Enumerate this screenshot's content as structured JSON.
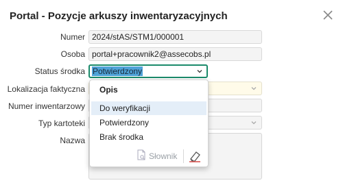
{
  "dialog": {
    "title": "Portal - Pozycje arkuszy inwentaryzacyjnych"
  },
  "fields": {
    "numer": {
      "label": "Numer",
      "value": "2024/stAS/STM1/000001"
    },
    "osoba": {
      "label": "Osoba",
      "value": "portal+pracownik2@assecobs.pl"
    },
    "status": {
      "label": "Status środka",
      "value": "Potwierdzony"
    },
    "lokalizacja": {
      "label": "Lokalizacja faktyczna",
      "value": ""
    },
    "numer_inw": {
      "label": "Numer inwentarzowy",
      "value": ""
    },
    "typ": {
      "label": "Typ kartoteki",
      "value": ""
    },
    "nazwa": {
      "label": "Nazwa",
      "value": ""
    }
  },
  "dropdown": {
    "header": "Opis",
    "options": [
      "Do weryfikacji",
      "Potwierdzony",
      "Brak środka"
    ],
    "highlighted_index": 0,
    "dictionary_label": "Słownik"
  },
  "colors": {
    "focus_border": "#1a8a6a",
    "selection": "#4fa3d8",
    "highlight": "#e4eef8",
    "eraser": "#d9534f"
  }
}
